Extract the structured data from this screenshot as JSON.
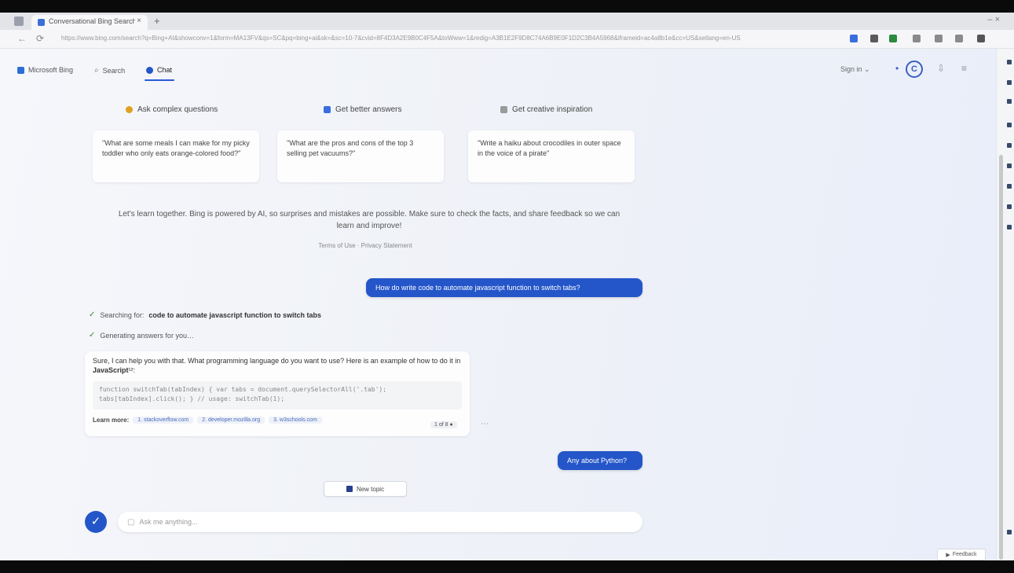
{
  "browser": {
    "tab_title": "Conversational Bing Search – ×",
    "tab_close": "×",
    "new_tab": "+",
    "window_controls": "– ×",
    "url": "https://www.bing.com/search?q=Bing+AI&showconv=1&form=MA13FV&qs=SC&pq=bing+ai&sk=&sc=10-7&cvid=8F4D3A2E9B0C4F5A&toWww=1&redig=A3B1E2F9D8C74A6B9E0F1D2C3B4A5968&iframeid=ac4a8b1e&cc=US&setlang=en-US",
    "nav_back": "←",
    "nav_refresh": "⟳",
    "extension_colors": [
      "#3a6ee0",
      "#5a5a5a",
      "#2b8a3e",
      "#8a8a8a",
      "#8a8a8a",
      "#8a8a8a",
      "#555555"
    ]
  },
  "header": {
    "brand": "Microsoft Bing",
    "search_tab": "Search",
    "chat_tab": "Chat",
    "language": "Sign in ⌄",
    "points_label": "C",
    "accent": "#2456c9"
  },
  "suggestions": [
    {
      "title": "Ask complex questions",
      "icon_color": "#e0a020",
      "prompt": "\"What are some meals I can make for my picky toddler who only eats orange-colored food?\""
    },
    {
      "title": "Get better answers",
      "icon_color": "#3a6ee0",
      "prompt": "\"What are the pros and cons of the top 3 selling pet vacuums?\""
    },
    {
      "title": "Get creative inspiration",
      "icon_color": "#9a9a9a",
      "prompt": "\"Write a haiku about crocodiles in outer space in the voice of a pirate\""
    }
  ],
  "disclaimer": {
    "text": "Let's learn together. Bing is powered by AI, so surprises and mistakes are possible. Make sure to check the facts, and share feedback so we can learn and improve!",
    "terms": "Terms of Use · Privacy Statement"
  },
  "conversation": {
    "user_message_1": "How do write code to automate javascript function to switch tabs?",
    "status_searching_prefix": "Searching for:",
    "status_searching_term": "code to automate javascript function to switch tabs",
    "status_generating": "Generating answers for you…",
    "bot_text": "Sure, I can help you with that. What programming language do you want to use? Here is an example of how to do it in",
    "bot_text_bold": "JavaScript",
    "bot_text_end": "¹²:",
    "code": "function switchTab(tabIndex) { var tabs = document.querySelectorAll('.tab'); tabs[tabIndex].click(); } // usage: switchTab(1);",
    "learn_more_label": "Learn more:",
    "learn_more_links": [
      "1. stackoverflow.com",
      "2. developer.mozilla.org",
      "3. w3schools.com"
    ],
    "count": "1 of 8 ●",
    "more": "⋯",
    "user_message_2": "Any about Python?"
  },
  "footer": {
    "new_topic": "New topic",
    "input_placeholder": "Ask me anything...",
    "avatar_icon": "✓",
    "feedback": "Feedback"
  }
}
